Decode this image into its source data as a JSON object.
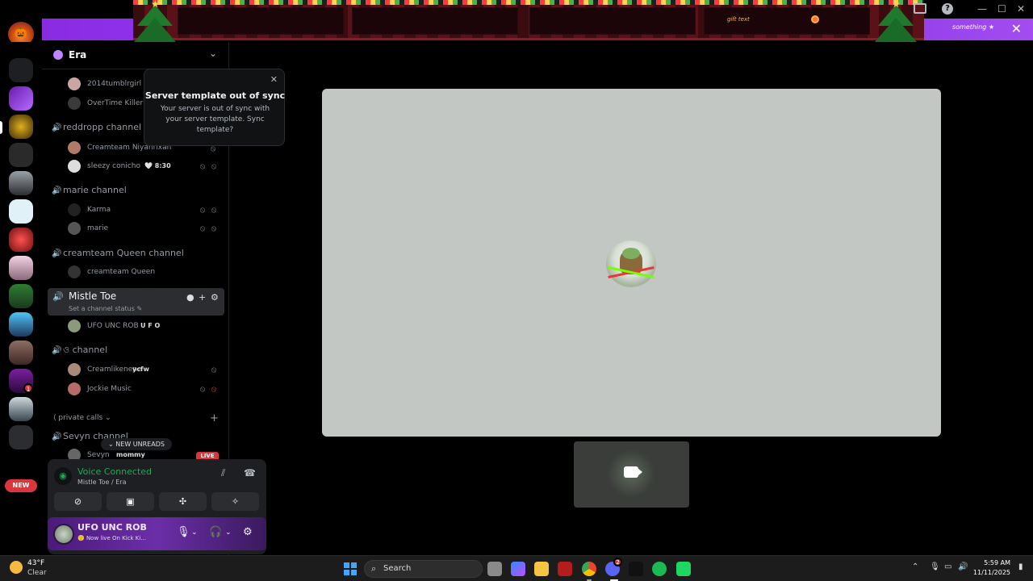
{
  "banner": {
    "gift_text": "gift text",
    "note": "something ★"
  },
  "colors": {
    "voice_green": "#23a55a",
    "accent_purple": "#8a2be2",
    "stage_bg": "#c2c7c3",
    "live_red": "#da373c"
  },
  "server": {
    "name": "Era",
    "rail_badge_count": "1",
    "new_label": "NEW"
  },
  "popup": {
    "title": "Server template out of sync",
    "body": "Your server is out of sync with your server template. Sync template?"
  },
  "sidebar": {
    "rows": [
      {
        "type": "user",
        "name": "2014tumblrgirl"
      },
      {
        "type": "user",
        "name": "OverTime Killer"
      },
      {
        "type": "channel",
        "name": "reddropp channel"
      },
      {
        "type": "user",
        "name": "Creamteam Niyahrixan"
      },
      {
        "type": "user",
        "name": "sleezy conicho",
        "tag": "🤍 8:30"
      },
      {
        "type": "channel",
        "name": "marie channel"
      },
      {
        "type": "user",
        "name": "Karma"
      },
      {
        "type": "user",
        "name": "marie"
      },
      {
        "type": "channel",
        "name": "creamteam Queen channel"
      },
      {
        "type": "user",
        "name": "creamteam Queen"
      },
      {
        "type": "user",
        "name": "UFO UNC ROB",
        "tag": "U F O"
      },
      {
        "type": "channel",
        "name": "ও channel"
      },
      {
        "type": "user",
        "name": "Creamlikenene",
        "tag": "ycfw"
      },
      {
        "type": "user",
        "name": "Jockie Music"
      },
      {
        "type": "channel",
        "name": "Sevyn channel"
      },
      {
        "type": "user",
        "name": "Sevyn",
        "tag": "mommy"
      }
    ],
    "active_channel": {
      "name": "Mistle Toe",
      "status": "Set a channel status ✎"
    },
    "category": "⟨ private calls ⌄",
    "new_unreads": "⌄ NEW UNREADS",
    "live_label": "LIVE"
  },
  "voice": {
    "title": "Voice Connected",
    "subtitle": "Mistle Toe / Era"
  },
  "user": {
    "name": "UFO UNC ROB",
    "status": "🙂 Now live On Kick Ki..."
  },
  "taskbar": {
    "temp": "43°F",
    "condition": "Clear",
    "search_label": "Search",
    "time": "5:59 AM",
    "date": "11/11/2025",
    "discord_badge": "2"
  },
  "icons": [
    "close-icon",
    "speaker-icon",
    "chevron-down-icon",
    "mute-icon",
    "deafen-icon",
    "chat-icon",
    "add-member-icon",
    "gear-icon",
    "camera-icon",
    "screen-share-icon",
    "activities-icon",
    "soundboard-icon",
    "mic-icon",
    "headphones-icon",
    "search-icon"
  ]
}
